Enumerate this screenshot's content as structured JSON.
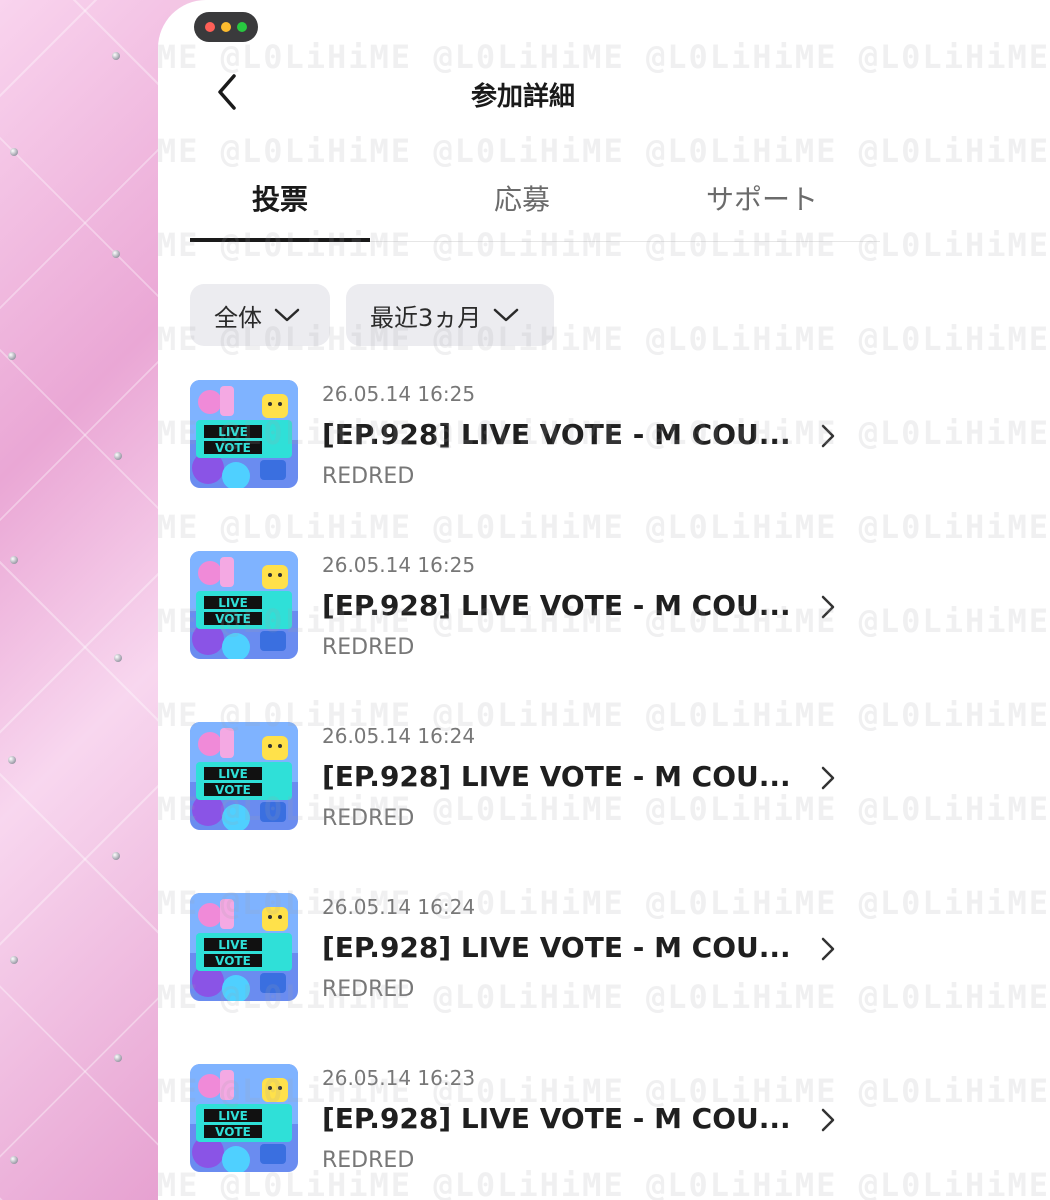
{
  "header": {
    "title": "参加詳細"
  },
  "tabs": [
    {
      "label": "投票",
      "active": true
    },
    {
      "label": "応募",
      "active": false
    },
    {
      "label": "サポート",
      "active": false
    }
  ],
  "filters": [
    {
      "label": "全体"
    },
    {
      "label": "最近3ヵ月"
    }
  ],
  "items": [
    {
      "date": "26.05.14 16:25",
      "title": "[EP.928] LIVE VOTE - M COU...",
      "sub": "REDRED",
      "thumb_top": "LIVE",
      "thumb_bottom": "VOTE"
    },
    {
      "date": "26.05.14 16:25",
      "title": "[EP.928] LIVE VOTE - M COU...",
      "sub": "REDRED",
      "thumb_top": "LIVE",
      "thumb_bottom": "VOTE"
    },
    {
      "date": "26.05.14 16:24",
      "title": "[EP.928] LIVE VOTE - M COU...",
      "sub": "REDRED",
      "thumb_top": "LIVE",
      "thumb_bottom": "VOTE"
    },
    {
      "date": "26.05.14 16:24",
      "title": "[EP.928] LIVE VOTE - M COU...",
      "sub": "REDRED",
      "thumb_top": "LIVE",
      "thumb_bottom": "VOTE"
    },
    {
      "date": "26.05.14 16:23",
      "title": "[EP.928] LIVE VOTE - M COU...",
      "sub": "REDRED",
      "thumb_top": "LIVE",
      "thumb_bottom": "VOTE"
    }
  ],
  "watermark": "@L0LiHiME",
  "colors": {
    "window_red": "#ff5f57",
    "window_yellow": "#febc2e",
    "window_green": "#28c840",
    "thumb_cyan": "#2fe0d8",
    "thumb_pink": "#f08ad8"
  }
}
